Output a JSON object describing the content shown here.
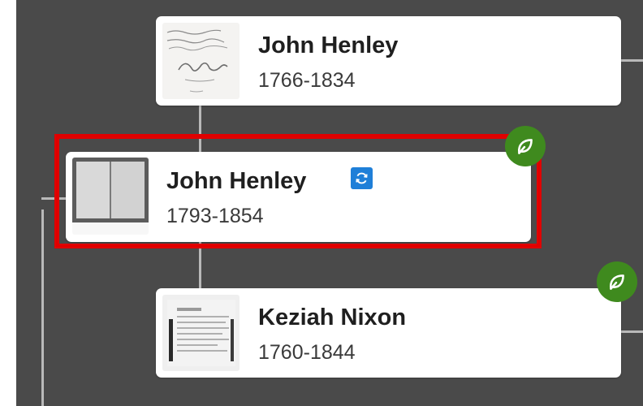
{
  "tree": {
    "father": {
      "name": "John Henley",
      "dates": "1766-1834",
      "thumb_icon": "handwritten-document-thumbnail"
    },
    "focus": {
      "name": "John Henley",
      "dates": "1793-1854",
      "thumb_icon": "record-book-thumbnail",
      "badge_icon": "sync-icon"
    },
    "mother": {
      "name": "Keziah Nixon",
      "dates": "1760-1844",
      "thumb_icon": "document-record-thumbnail"
    }
  },
  "hints": {
    "icon": "leaf-hint-icon",
    "color": "#3f8a1e"
  },
  "colors": {
    "background": "#4a4a4a",
    "card": "#ffffff",
    "connector": "#b9b9b9",
    "highlight": "#e00000",
    "badge": "#1f7fd8"
  }
}
